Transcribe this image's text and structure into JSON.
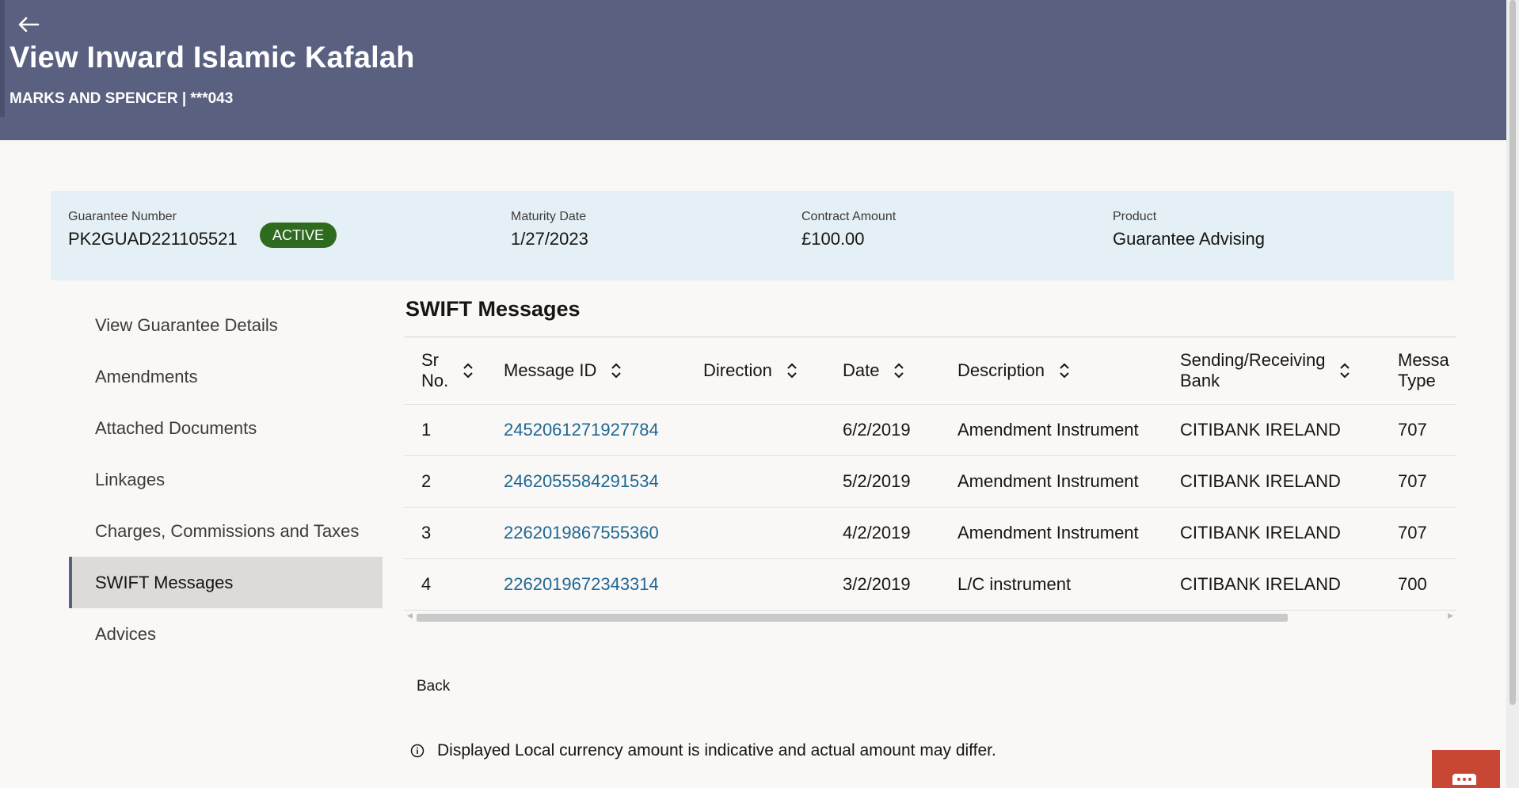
{
  "header": {
    "title": "View Inward Islamic Kafalah",
    "subtitle": "MARKS AND SPENCER | ***043",
    "back_icon": "arrow-left-icon"
  },
  "summary": {
    "guarantee_label": "Guarantee Number",
    "guarantee_value": "PK2GUAD221105521",
    "status": "ACTIVE",
    "maturity_label": "Maturity Date",
    "maturity_value": "1/27/2023",
    "amount_label": "Contract Amount",
    "amount_value": "£100.00",
    "product_label": "Product",
    "product_value": "Guarantee Advising"
  },
  "sidenav": {
    "items": [
      {
        "label": "View Guarantee Details"
      },
      {
        "label": "Amendments"
      },
      {
        "label": "Attached Documents"
      },
      {
        "label": "Linkages"
      },
      {
        "label": "Charges, Commissions and Taxes"
      },
      {
        "label": "SWIFT Messages"
      },
      {
        "label": "Advices"
      }
    ],
    "active_index": 5
  },
  "main": {
    "section_title": "SWIFT Messages",
    "columns": [
      {
        "line1": "Sr",
        "line2": "No."
      },
      {
        "line1": "Message ID",
        "line2": ""
      },
      {
        "line1": "Direction",
        "line2": ""
      },
      {
        "line1": "Date",
        "line2": ""
      },
      {
        "line1": "Description",
        "line2": ""
      },
      {
        "line1": "Sending/Receiving",
        "line2": "Bank"
      },
      {
        "line1": "Messa",
        "line2": "Type"
      }
    ],
    "rows": [
      {
        "sr": "1",
        "message_id": "2452061271927784",
        "direction": "",
        "date": "6/2/2019",
        "description": "Amendment Instrument",
        "bank": "CITIBANK IRELAND",
        "type": "707"
      },
      {
        "sr": "2",
        "message_id": "2462055584291534",
        "direction": "",
        "date": "5/2/2019",
        "description": "Amendment Instrument",
        "bank": "CITIBANK IRELAND",
        "type": "707"
      },
      {
        "sr": "3",
        "message_id": "2262019867555360",
        "direction": "",
        "date": "4/2/2019",
        "description": "Amendment Instrument",
        "bank": "CITIBANK IRELAND",
        "type": "707"
      },
      {
        "sr": "4",
        "message_id": "2262019672343314",
        "direction": "",
        "date": "3/2/2019",
        "description": "L/C instrument",
        "bank": "CITIBANK IRELAND",
        "type": "700"
      }
    ],
    "back_label": "Back",
    "note": "Displayed Local currency amount is indicative and actual amount may differ."
  },
  "colors": {
    "header_bg": "#5a6080",
    "summary_bg": "#e4f0f6",
    "active_badge": "#2e6b1f",
    "link": "#1f6793",
    "chat_button": "#c74634"
  }
}
